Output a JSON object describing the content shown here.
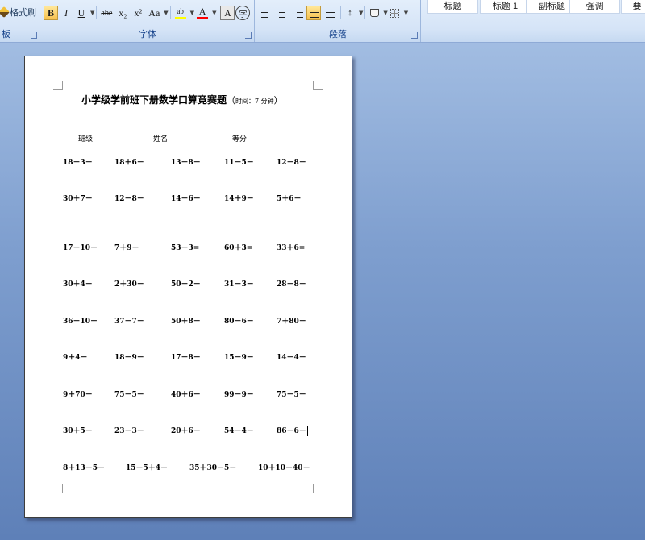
{
  "ribbon": {
    "clipboard": {
      "format_painter": "格式刷",
      "group_label": "板"
    },
    "font": {
      "group_label": "字体",
      "bold": "B",
      "italic": "I",
      "underline": "U",
      "strike": "abe",
      "subscript": "x₂",
      "superscript": "x²",
      "change_case": "Aa",
      "highlight": "ab",
      "font_color": "A",
      "char_shading": "A",
      "enclose": "字"
    },
    "paragraph": {
      "group_label": "段落",
      "line_spacing": "↕"
    },
    "styles": [
      "标题",
      "标题 1",
      "副标题",
      "强调",
      "要"
    ],
    "colors": {
      "highlight": "#ffff00",
      "font_color": "#ff0000",
      "active": "#f7c14d"
    }
  },
  "document": {
    "title": "小学级学前班下册数学口算竞赛题",
    "title_open": "（",
    "title_sub": "时间：7 分钟",
    "title_close": "）",
    "info": {
      "class_label": "班级",
      "name_label": "姓名",
      "score_label": "等分"
    },
    "problems": [
      [
        "18－3－",
        "18＋6－",
        "13－8－",
        "11－5－",
        "12－8－"
      ],
      [
        "30＋7－",
        "12－8－",
        "14－6－",
        "14＋9－",
        "5＋6－"
      ],
      [
        "17－10－",
        "7＋9－",
        "53－3=",
        "60＋3=",
        "33＋6="
      ],
      [
        "30＋4－",
        "2＋30－",
        "50－2－",
        "31－3－",
        "28－8－"
      ],
      [
        "36－10－",
        "37－7－",
        "50＋8－",
        "80－6－",
        "7＋80－"
      ],
      [
        "9＋4－",
        "18－9－",
        "17－8－",
        "15－9－",
        "14－4－"
      ],
      [
        "9＋70－",
        "75－5－",
        "40＋6－",
        "99－9－",
        "75－5－"
      ],
      [
        "30＋5－",
        "23－3－",
        "20＋6－",
        "54－4－",
        "86－6－"
      ]
    ],
    "last_row": [
      "8＋13－5－",
      "15－5＋4－",
      "35＋30－5－",
      "10＋10＋40－"
    ]
  }
}
